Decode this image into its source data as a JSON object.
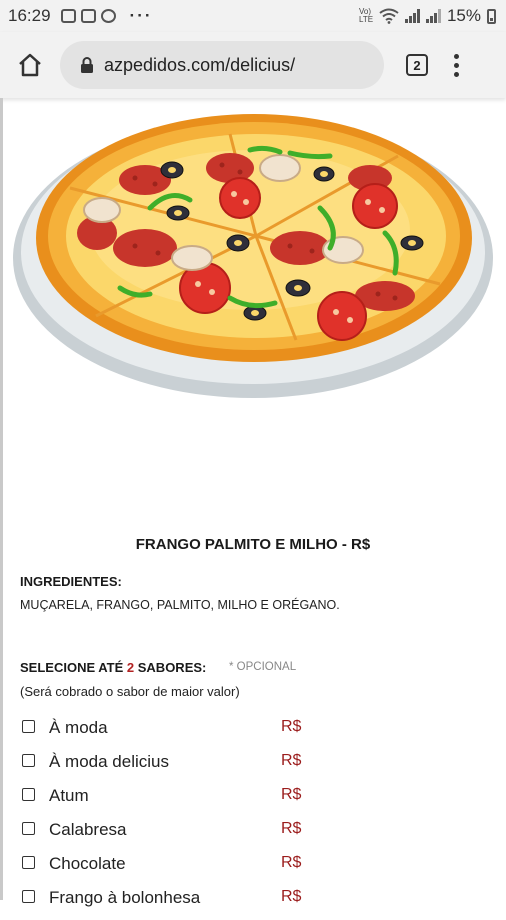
{
  "status_bar": {
    "time": "16:29",
    "volte": "Vo) LTE",
    "battery": "15%",
    "more": "···",
    "icons": [
      "gallery-icon",
      "instagram-icon",
      "whatsapp-icon",
      "wifi-icon",
      "signal-icon",
      "battery-icon"
    ]
  },
  "browser": {
    "url": "azpedidos.com/delicius/",
    "tab_count": "2"
  },
  "product": {
    "title": "FRANGO PALMITO E MILHO - R$",
    "ingredients_heading": "INGREDIENTES:",
    "ingredients": "MUÇARELA, FRANGO, PALMITO, MILHO E ORÉGANO."
  },
  "flavors": {
    "heading_prefix": "SELECIONE ATÉ ",
    "heading_num": "2",
    "heading_suffix": " SABORES:",
    "optional": "* OPCIONAL",
    "note": "(Será cobrado o sabor de maior valor)",
    "options": [
      {
        "label": "À moda",
        "price": "R$"
      },
      {
        "label": "À moda delicius",
        "price": "R$"
      },
      {
        "label": "Atum",
        "price": "R$"
      },
      {
        "label": "Calabresa",
        "price": "R$"
      },
      {
        "label": "Chocolate",
        "price": "R$"
      },
      {
        "label": "Frango à bolonhesa",
        "price": "R$"
      }
    ]
  },
  "colors": {
    "price": "#9b1c1c",
    "highlight_number": "#b22222",
    "chrome_bg": "#f2f2f2"
  }
}
